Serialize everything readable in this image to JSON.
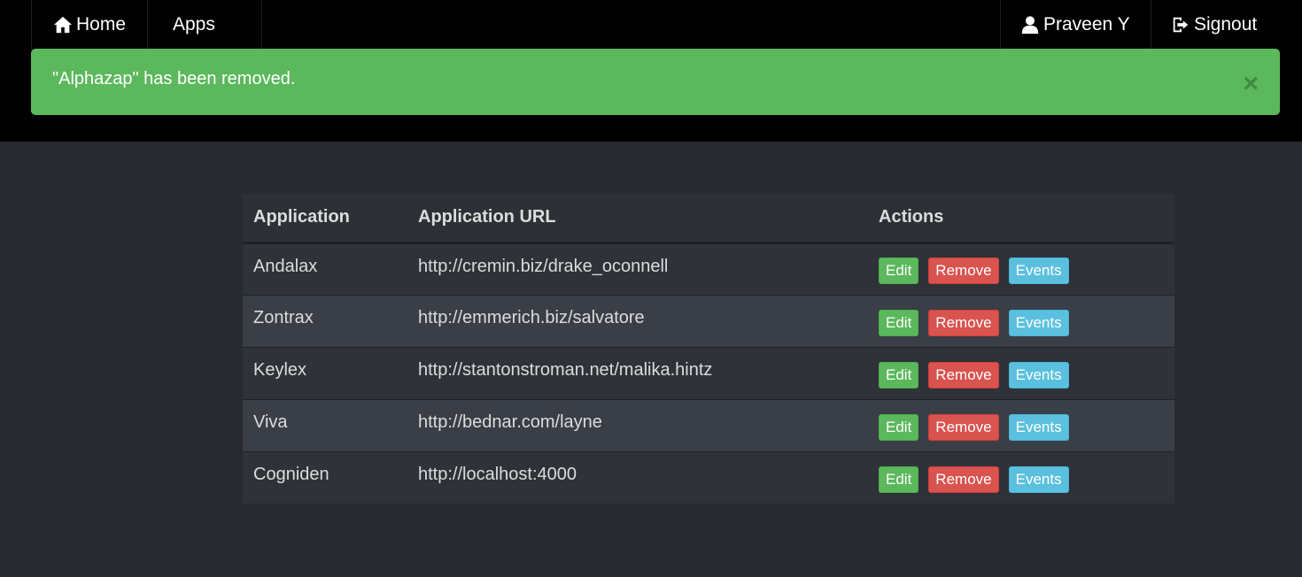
{
  "nav": {
    "home_label": "Home",
    "apps_label": "Apps",
    "user_label": "Praveen Y",
    "signout_label": "Signout"
  },
  "alert": {
    "message": "\"Alphazap\" has been removed.",
    "close_symbol": "×",
    "color": "#5cb85c"
  },
  "table": {
    "headers": [
      "Application",
      "Application URL",
      "Actions"
    ],
    "rows": [
      {
        "name": "Andalax",
        "url": "http://cremin.biz/drake_oconnell"
      },
      {
        "name": "Zontrax",
        "url": "http://emmerich.biz/salvatore"
      },
      {
        "name": "Keylex",
        "url": "http://stantonstroman.net/malika.hintz"
      },
      {
        "name": "Viva",
        "url": "http://bednar.com/layne"
      },
      {
        "name": "Cogniden",
        "url": "http://localhost:4000"
      }
    ],
    "actions": {
      "edit_label": "Edit",
      "remove_label": "Remove",
      "events_label": "Events"
    }
  },
  "icons": {
    "home": "home-icon",
    "user": "user-icon",
    "signout": "signout-icon"
  }
}
